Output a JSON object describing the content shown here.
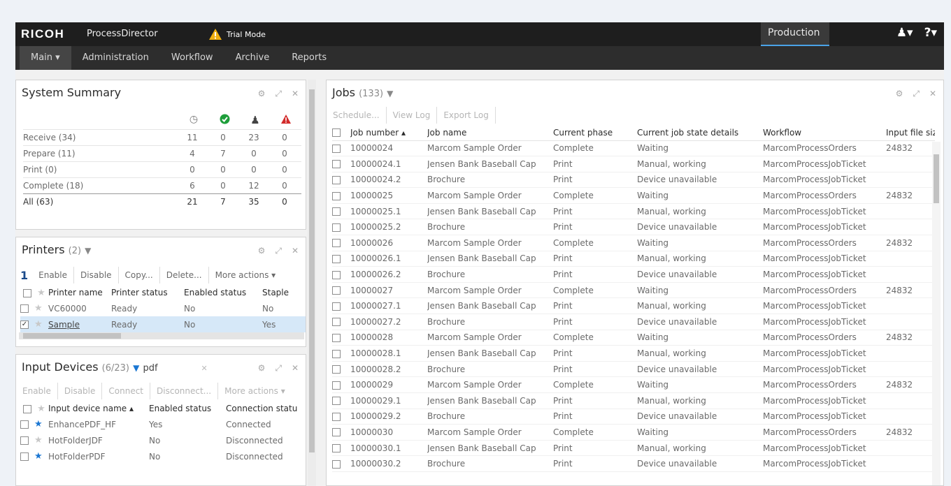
{
  "topbar": {
    "brand": "RICOH",
    "app": "ProcessDirector",
    "trial": "Trial Mode",
    "mode": "Production",
    "user_icon": "user-icon",
    "help_icon": "help-icon"
  },
  "nav": [
    "Main",
    "Administration",
    "Workflow",
    "Archive",
    "Reports"
  ],
  "summary": {
    "title": "System Summary",
    "rows": [
      {
        "label": "Receive (34)",
        "v": [
          "11",
          "0",
          "23",
          "0"
        ]
      },
      {
        "label": "Prepare (11)",
        "v": [
          "4",
          "7",
          "0",
          "0"
        ]
      },
      {
        "label": "Print (0)",
        "v": [
          "0",
          "0",
          "0",
          "0"
        ]
      },
      {
        "label": "Complete (18)",
        "v": [
          "6",
          "0",
          "12",
          "0"
        ]
      },
      {
        "label": "All (63)",
        "v": [
          "21",
          "7",
          "35",
          "0"
        ]
      }
    ]
  },
  "printers": {
    "title": "Printers",
    "count": "(2)",
    "selected": "1",
    "actions": [
      "Enable",
      "Disable",
      "Copy...",
      "Delete...",
      "More actions"
    ],
    "headers": [
      "Printer name",
      "Printer status",
      "Enabled status",
      "Staple"
    ],
    "rows": [
      {
        "name": "VC60000",
        "status": "Ready",
        "enabled": "No",
        "staple": "No",
        "selected": false
      },
      {
        "name": "Sample",
        "status": "Ready",
        "enabled": "No",
        "staple": "Yes",
        "selected": true
      }
    ]
  },
  "inputs": {
    "title": "Input Devices",
    "count": "(6/23)",
    "filter": "pdf",
    "actions": [
      "Enable",
      "Disable",
      "Connect",
      "Disconnect...",
      "More actions"
    ],
    "headers": [
      "Input device name",
      "Enabled status",
      "Connection statu"
    ],
    "rows": [
      {
        "name": "EnhancePDF_HF",
        "enabled": "Yes",
        "conn": "Connected",
        "fav": true
      },
      {
        "name": "HotFolderJDF",
        "enabled": "No",
        "conn": "Disconnected",
        "fav": false
      },
      {
        "name": "HotFolderPDF",
        "enabled": "No",
        "conn": "Disconnected",
        "fav": true
      }
    ]
  },
  "jobs": {
    "title": "Jobs",
    "count": "(133)",
    "actions": [
      "Schedule...",
      "View Log",
      "Export Log"
    ],
    "headers": [
      "Job number",
      "Job name",
      "Current phase",
      "Current job state details",
      "Workflow",
      "Input file siz"
    ],
    "rows": [
      {
        "num": "10000024",
        "name": "Marcom Sample Order",
        "phase": "Complete",
        "state": "Waiting",
        "wf": "MarcomProcessOrders",
        "size": "24832"
      },
      {
        "num": "10000024.1",
        "name": "Jensen Bank Baseball Cap",
        "phase": "Print",
        "state": "Manual, working",
        "wf": "MarcomProcessJobTicket",
        "size": ""
      },
      {
        "num": "10000024.2",
        "name": "Brochure",
        "phase": "Print",
        "state": "Device unavailable",
        "wf": "MarcomProcessJobTicket",
        "size": ""
      },
      {
        "num": "10000025",
        "name": "Marcom Sample Order",
        "phase": "Complete",
        "state": "Waiting",
        "wf": "MarcomProcessOrders",
        "size": "24832"
      },
      {
        "num": "10000025.1",
        "name": "Jensen Bank Baseball Cap",
        "phase": "Print",
        "state": "Manual, working",
        "wf": "MarcomProcessJobTicket",
        "size": ""
      },
      {
        "num": "10000025.2",
        "name": "Brochure",
        "phase": "Print",
        "state": "Device unavailable",
        "wf": "MarcomProcessJobTicket",
        "size": ""
      },
      {
        "num": "10000026",
        "name": "Marcom Sample Order",
        "phase": "Complete",
        "state": "Waiting",
        "wf": "MarcomProcessOrders",
        "size": "24832"
      },
      {
        "num": "10000026.1",
        "name": "Jensen Bank Baseball Cap",
        "phase": "Print",
        "state": "Manual, working",
        "wf": "MarcomProcessJobTicket",
        "size": ""
      },
      {
        "num": "10000026.2",
        "name": "Brochure",
        "phase": "Print",
        "state": "Device unavailable",
        "wf": "MarcomProcessJobTicket",
        "size": ""
      },
      {
        "num": "10000027",
        "name": "Marcom Sample Order",
        "phase": "Complete",
        "state": "Waiting",
        "wf": "MarcomProcessOrders",
        "size": "24832"
      },
      {
        "num": "10000027.1",
        "name": "Jensen Bank Baseball Cap",
        "phase": "Print",
        "state": "Manual, working",
        "wf": "MarcomProcessJobTicket",
        "size": ""
      },
      {
        "num": "10000027.2",
        "name": "Brochure",
        "phase": "Print",
        "state": "Device unavailable",
        "wf": "MarcomProcessJobTicket",
        "size": ""
      },
      {
        "num": "10000028",
        "name": "Marcom Sample Order",
        "phase": "Complete",
        "state": "Waiting",
        "wf": "MarcomProcessOrders",
        "size": "24832"
      },
      {
        "num": "10000028.1",
        "name": "Jensen Bank Baseball Cap",
        "phase": "Print",
        "state": "Manual, working",
        "wf": "MarcomProcessJobTicket",
        "size": ""
      },
      {
        "num": "10000028.2",
        "name": "Brochure",
        "phase": "Print",
        "state": "Device unavailable",
        "wf": "MarcomProcessJobTicket",
        "size": ""
      },
      {
        "num": "10000029",
        "name": "Marcom Sample Order",
        "phase": "Complete",
        "state": "Waiting",
        "wf": "MarcomProcessOrders",
        "size": "24832"
      },
      {
        "num": "10000029.1",
        "name": "Jensen Bank Baseball Cap",
        "phase": "Print",
        "state": "Manual, working",
        "wf": "MarcomProcessJobTicket",
        "size": ""
      },
      {
        "num": "10000029.2",
        "name": "Brochure",
        "phase": "Print",
        "state": "Device unavailable",
        "wf": "MarcomProcessJobTicket",
        "size": ""
      },
      {
        "num": "10000030",
        "name": "Marcom Sample Order",
        "phase": "Complete",
        "state": "Waiting",
        "wf": "MarcomProcessOrders",
        "size": "24832"
      },
      {
        "num": "10000030.1",
        "name": "Jensen Bank Baseball Cap",
        "phase": "Print",
        "state": "Manual, working",
        "wf": "MarcomProcessJobTicket",
        "size": ""
      },
      {
        "num": "10000030.2",
        "name": "Brochure",
        "phase": "Print",
        "state": "Device unavailable",
        "wf": "MarcomProcessJobTicket",
        "size": ""
      }
    ]
  },
  "colors": {
    "accent": "#1a76d2",
    "ok": "#1e9e3a",
    "error": "#d22a2a",
    "selected_row": "#d6e8f8"
  }
}
